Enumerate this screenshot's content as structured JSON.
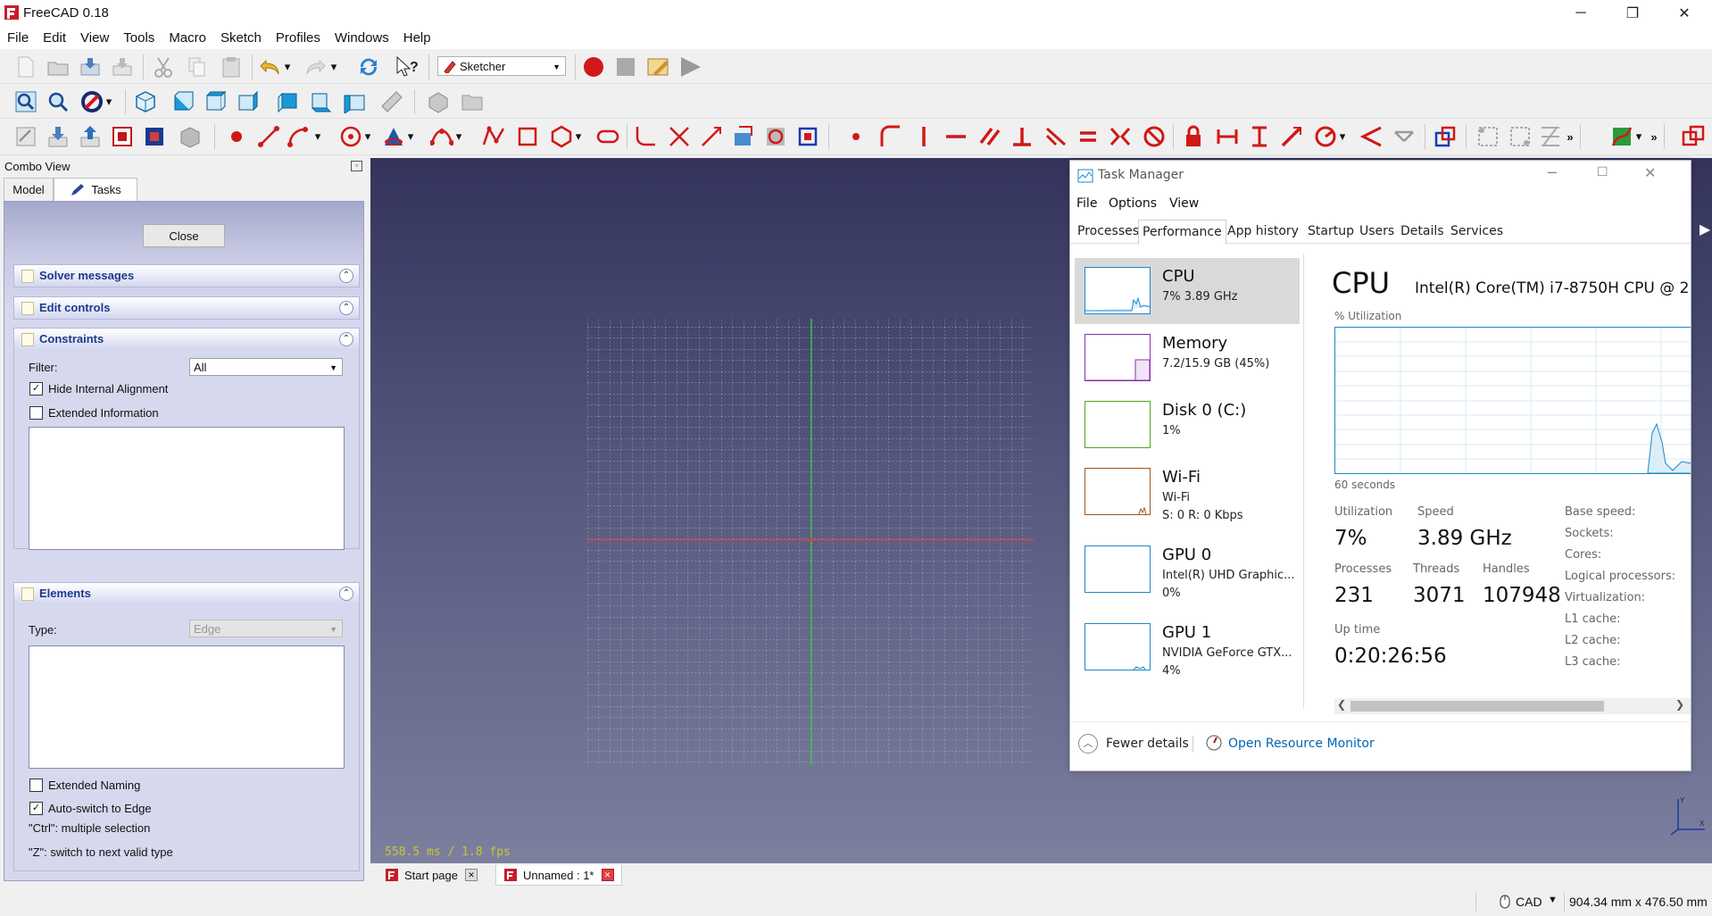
{
  "window": {
    "title": "FreeCAD 0.18",
    "minimize": "─",
    "maximize": "❐",
    "close": "✕"
  },
  "menu": [
    "File",
    "Edit",
    "View",
    "Tools",
    "Macro",
    "Sketch",
    "Profiles",
    "Windows",
    "Help"
  ],
  "toolbar": {
    "workbench": "Sketcher"
  },
  "combo": {
    "header": "Combo View",
    "tabs": [
      "Model",
      "Tasks"
    ],
    "close_label": "Close",
    "sections": {
      "solver": "Solver messages",
      "edit": "Edit controls",
      "constraints": "Constraints",
      "elements": "Elements"
    },
    "filter_label": "Filter:",
    "filter_value": "All",
    "hide_internal": "Hide Internal Alignment",
    "extended_info": "Extended Information",
    "type_label": "Type:",
    "type_value": "Edge",
    "extended_naming": "Extended Naming",
    "auto_switch": "Auto-switch to Edge",
    "hint_ctrl": "\"Ctrl\": multiple selection",
    "hint_z": "\"Z\": switch to next valid type"
  },
  "view": {
    "fps": "558.5 ms / 1.8 fps"
  },
  "doc_tabs": [
    {
      "label": "Start page"
    },
    {
      "label": "Unnamed : 1*"
    }
  ],
  "status": {
    "nav": "CAD",
    "dims": "904.34 mm x 476.50 mm"
  },
  "task_manager": {
    "title": "Task Manager",
    "menu": [
      "File",
      "Options",
      "View"
    ],
    "tabs": [
      "Processes",
      "Performance",
      "App history",
      "Startup",
      "Users",
      "Details",
      "Services"
    ],
    "items": [
      {
        "name": "CPU",
        "sub1": "7% 3.89 GHz",
        "sub2": ""
      },
      {
        "name": "Memory",
        "sub1": "7.2/15.9 GB (45%)",
        "sub2": ""
      },
      {
        "name": "Disk 0 (C:)",
        "sub1": "1%",
        "sub2": ""
      },
      {
        "name": "Wi-Fi",
        "sub1": "Wi-Fi",
        "sub2": "S: 0 R: 0 Kbps"
      },
      {
        "name": "GPU 0",
        "sub1": "Intel(R) UHD Graphic...",
        "sub2": "0%"
      },
      {
        "name": "GPU 1",
        "sub1": "NVIDIA GeForce GTX...",
        "sub2": "4%"
      }
    ],
    "cpu": {
      "heading": "CPU",
      "model": "Intel(R) Core(TM) i7-8750H CPU @ 2",
      "graph_label": "% Utilization",
      "graph_footer": "60 seconds",
      "utilization_label": "Utilization",
      "utilization": "7%",
      "speed_label": "Speed",
      "speed": "3.89 GHz",
      "processes_label": "Processes",
      "processes": "231",
      "threads_label": "Threads",
      "threads": "3071",
      "handles_label": "Handles",
      "handles": "107948",
      "uptime_label": "Up time",
      "uptime": "0:20:26:56",
      "right_labels": [
        "Base speed:",
        "Sockets:",
        "Cores:",
        "Logical processors:",
        "Virtualization:",
        "L1 cache:",
        "L2 cache:",
        "L3 cache:"
      ]
    },
    "fewer_details": "Fewer details",
    "resource_monitor": "Open Resource Monitor"
  },
  "colors": {
    "accent": "#0066b4",
    "cpu_line": "#1a88c9",
    "memory_line": "#8b2bb0",
    "disk_line": "#4ca81a",
    "wifi_line": "#a0561a",
    "red": "#cc0000"
  }
}
